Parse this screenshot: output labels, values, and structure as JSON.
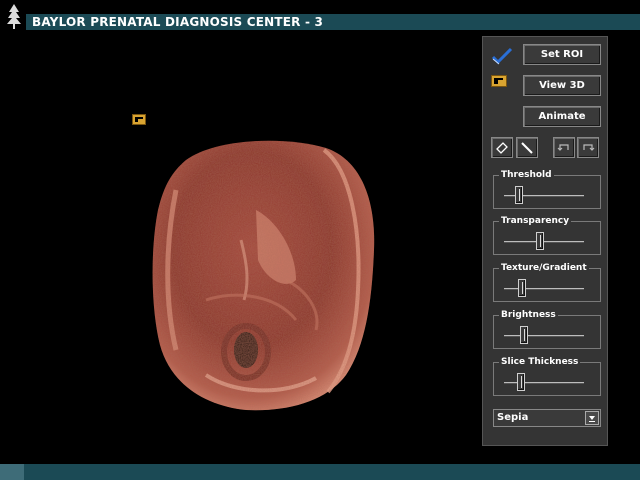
{
  "window": {
    "title": "BAYLOR PRENATAL DIAGNOSIS CENTER - 3",
    "system_icon": "tree-icon",
    "bar_color": "#1b4a55"
  },
  "viewport": {
    "roi_marker_icon": "roi-square-icon",
    "image": "fetal-3d-ultrasound-render",
    "tint": "sepia"
  },
  "panel": {
    "set_roi_label": "Set ROI",
    "view_3d_label": "View 3D",
    "animate_label": "Animate",
    "set_roi_icon": "checkmark-icon",
    "view_3d_icon": "roi-square-icon",
    "tools": [
      "eraser-icon",
      "scalpel-icon",
      "undo-icon",
      "redo-icon"
    ],
    "sliders": [
      {
        "label": "Threshold",
        "value": 0.15
      },
      {
        "label": "Transparency",
        "value": 0.45
      },
      {
        "label": "Texture/Gradient",
        "value": 0.2
      },
      {
        "label": "Brightness",
        "value": 0.22
      },
      {
        "label": "Slice Thickness",
        "value": 0.18
      }
    ],
    "colormap": {
      "selected": "Sepia"
    }
  },
  "colors": {
    "panel": "#343434",
    "accent": "#2a6fd6",
    "gold": "#d9a431"
  }
}
